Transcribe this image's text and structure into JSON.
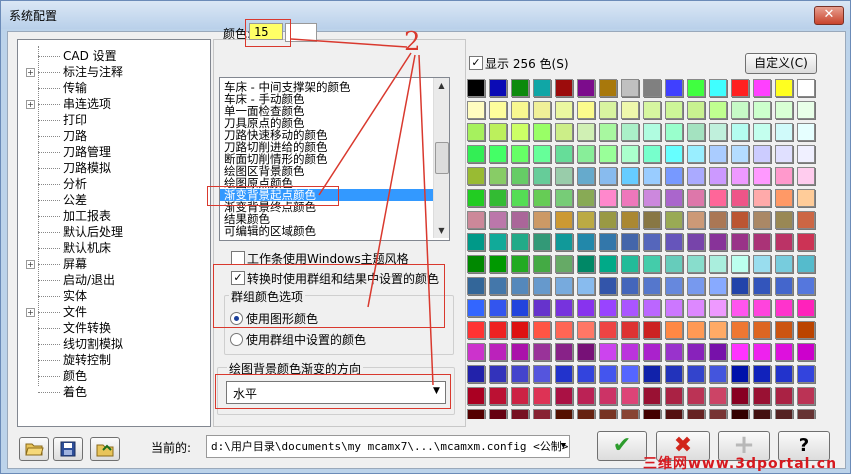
{
  "window": {
    "title": "系统配置",
    "close_label": "✕"
  },
  "tree": {
    "items": [
      {
        "label": "CAD 设置",
        "expandable": false
      },
      {
        "label": "标注与注释",
        "expandable": true
      },
      {
        "label": "传输",
        "expandable": false
      },
      {
        "label": "串连选项",
        "expandable": true
      },
      {
        "label": "打印",
        "expandable": false
      },
      {
        "label": "刀路",
        "expandable": false
      },
      {
        "label": "刀路管理",
        "expandable": false
      },
      {
        "label": "刀路模拟",
        "expandable": false
      },
      {
        "label": "分析",
        "expandable": false
      },
      {
        "label": "公差",
        "expandable": false
      },
      {
        "label": "加工报表",
        "expandable": false
      },
      {
        "label": "默认后处理",
        "expandable": false
      },
      {
        "label": "默认机床",
        "expandable": false
      },
      {
        "label": "屏幕",
        "expandable": true
      },
      {
        "label": "启动/退出",
        "expandable": false
      },
      {
        "label": "实体",
        "expandable": false
      },
      {
        "label": "文件",
        "expandable": true
      },
      {
        "label": "文件转换",
        "expandable": false
      },
      {
        "label": "线切割模拟",
        "expandable": false
      },
      {
        "label": "旋转控制",
        "expandable": false
      },
      {
        "label": "颜色",
        "expandable": false
      },
      {
        "label": "着色",
        "expandable": false
      }
    ]
  },
  "color_panel": {
    "color_label": "颜色:",
    "color_value": "15",
    "list": [
      "车床 - 中间支撑架的颜色",
      "车床 - 手动颜色",
      "单一面检查颜色",
      "刀具原点的颜色",
      "刀路快速移动的颜色",
      "刀路切削进给的颜色",
      "断面切削情形的颜色",
      "绘图区背景颜色",
      "绘图原点颜色",
      "渐变背景起点颜色",
      "渐变背景终点颜色",
      "结果颜色",
      "可编辑的区域颜色"
    ],
    "selected_index": 9,
    "toolbar_windows_theme": "工作条使用Windows主题风格",
    "toolbar_windows_theme_checked": false,
    "use_group_colors": "转换时使用群组和结果中设置的颜色",
    "use_group_colors_checked": true,
    "group_options_title": "群组颜色选项",
    "radio_use_graphic": "使用图形颜色",
    "radio_use_group": "使用群组中设置的颜色",
    "radio_selected": "graphic",
    "gradient_title": "绘图背景颜色渐变的方向",
    "gradient_value": "水平"
  },
  "palette_header": {
    "show_256_label": "显示 256 色(S)",
    "show_256_checked": true,
    "custom_button": "自定义(C)"
  },
  "footer": {
    "current_label": "当前的:",
    "current_path": "d:\\用户目录\\documents\\my mcamx7\\...\\mcamxm.config <公制>",
    "ok_icon": "✔",
    "cancel_icon": "✖",
    "add_icon": "+",
    "help_icon": "?"
  },
  "annotation": {
    "number": "2"
  },
  "watermark": "三维网www.3dportal.cn",
  "colors": {
    "accent_selection": "#3399ff",
    "annotation_red": "#d9392e",
    "color_field": "#ffff66"
  },
  "palette_rows": [
    [
      "#000000",
      "#0b0bb5",
      "#0c8a0c",
      "#10a6a6",
      "#9c0c0c",
      "#7c0c8c",
      "#a8780c",
      "#c0c0c0",
      "#808080",
      "#4040ff",
      "#40ff40",
      "#40ffff",
      "#ff2020",
      "#ff40ff",
      "#ffff20",
      "#ffffff"
    ],
    [
      "#fffcc0",
      "#fdfd9c",
      "#f8f890",
      "#f0f098",
      "#eaf7a0",
      "#fbfb8c",
      "#d8f4a0",
      "#eef8ac",
      "#d6f6a0",
      "#cdf698",
      "#c8f290",
      "#c0ff90",
      "#c6fac6",
      "#ccffcc",
      "#d8ffd4",
      "#e8ffe8"
    ],
    [
      "#a6f15e",
      "#bcf05c",
      "#ccff66",
      "#99ff66",
      "#ccee88",
      "#d0f0b4",
      "#a8f8a0",
      "#aaf0c8",
      "#b0fce0",
      "#99ffcc",
      "#a4e2c0",
      "#c0f0dc",
      "#b4fcf0",
      "#c4ffee",
      "#d0fafa",
      "#e6ffff"
    ],
    [
      "#33ee55",
      "#44ff66",
      "#66ff66",
      "#66ff99",
      "#66dd99",
      "#88ee99",
      "#99ff99",
      "#aaffcc",
      "#77ffcc",
      "#66ffff",
      "#99eeff",
      "#aaccff",
      "#b4dcff",
      "#ccccff",
      "#e0e0ff",
      "#f0f0ff"
    ],
    [
      "#99bb33",
      "#88cc66",
      "#66cc66",
      "#66cc99",
      "#99ccaa",
      "#66aacc",
      "#88bbee",
      "#66ccff",
      "#99ccff",
      "#7799ff",
      "#aaaaff",
      "#cc99ff",
      "#ee99ff",
      "#ff99ff",
      "#ff99cc",
      "#ffccee"
    ],
    [
      "#22cc22",
      "#33bb33",
      "#55dd55",
      "#66cc55",
      "#77cc77",
      "#88aa55",
      "#ff88cc",
      "#ee77bb",
      "#cc88dd",
      "#aa66cc",
      "#dd77aa",
      "#ff6699",
      "#ee5588",
      "#ffaaaa",
      "#ff9966",
      "#ffcc99"
    ],
    [
      "#cc8899",
      "#bb77aa",
      "#aa6699",
      "#cc9966",
      "#cc9933",
      "#bbaa44",
      "#999944",
      "#aa8833",
      "#887744",
      "#99aa55",
      "#cc9977",
      "#aa7755",
      "#bb5533",
      "#aa8866",
      "#998855",
      "#cc6644"
    ],
    [
      "#009988",
      "#11aa99",
      "#22aa88",
      "#339977",
      "#119999",
      "#2288aa",
      "#3377aa",
      "#4466aa",
      "#5566bb",
      "#6655bb",
      "#7744aa",
      "#883399",
      "#993388",
      "#aa3377",
      "#bb3366",
      "#cc3355"
    ],
    [
      "#008800",
      "#009900",
      "#22aa22",
      "#44aa44",
      "#66aa66",
      "#008866",
      "#00aa88",
      "#22bb99",
      "#44ccaa",
      "#66ccbb",
      "#88ddcc",
      "#aaeedd",
      "#bbffee",
      "#99ddee",
      "#77ccdd",
      "#55bbcc"
    ],
    [
      "#336699",
      "#4477aa",
      "#5588bb",
      "#6699cc",
      "#77aadd",
      "#88bbee",
      "#3355aa",
      "#4466bb",
      "#5577cc",
      "#6688dd",
      "#7799ee",
      "#88aaff",
      "#2244aa",
      "#3355bb",
      "#4466cc",
      "#5577dd"
    ],
    [
      "#3366ff",
      "#3355ee",
      "#2244dd",
      "#6633cc",
      "#7733dd",
      "#8833ee",
      "#9944ff",
      "#aa55ff",
      "#bb66ff",
      "#cc77ff",
      "#dd88ff",
      "#ee99ff",
      "#ff55ee",
      "#ff44dd",
      "#ff33cc",
      "#ff22bb"
    ],
    [
      "#ff3333",
      "#ee2222",
      "#dd1111",
      "#ff5544",
      "#ff6655",
      "#ff7766",
      "#ee4444",
      "#dd3333",
      "#cc2222",
      "#ff8844",
      "#ff9955",
      "#ffaa66",
      "#ee7733",
      "#dd6622",
      "#cc5511",
      "#bb4400"
    ],
    [
      "#cc33cc",
      "#bb22bb",
      "#aa11aa",
      "#993399",
      "#882288",
      "#771177",
      "#cc44ee",
      "#bb33dd",
      "#aa22cc",
      "#9933cc",
      "#8822bb",
      "#7711aa",
      "#ff33ff",
      "#ee22ee",
      "#dd11dd",
      "#cc00cc"
    ],
    [
      "#2222aa",
      "#3333bb",
      "#4444cc",
      "#5555dd",
      "#2233cc",
      "#3344dd",
      "#4455ee",
      "#5566ff",
      "#1122aa",
      "#2233bb",
      "#3344cc",
      "#4455dd",
      "#0011aa",
      "#1122bb",
      "#2233cc",
      "#3344dd"
    ],
    [
      "#aa0022",
      "#bb1133",
      "#cc2244",
      "#dd3355",
      "#aa1144",
      "#bb2255",
      "#cc3366",
      "#dd4477",
      "#991133",
      "#aa2244",
      "#bb3355",
      "#cc4466",
      "#880022",
      "#991133",
      "#aa2244",
      "#bb3355"
    ],
    [
      "#550000",
      "#660011",
      "#771122",
      "#882233",
      "#551100",
      "#662211",
      "#773322",
      "#884433",
      "#440000",
      "#551111",
      "#662222",
      "#773333",
      "#330000",
      "#441111",
      "#552222",
      "#663333"
    ]
  ]
}
